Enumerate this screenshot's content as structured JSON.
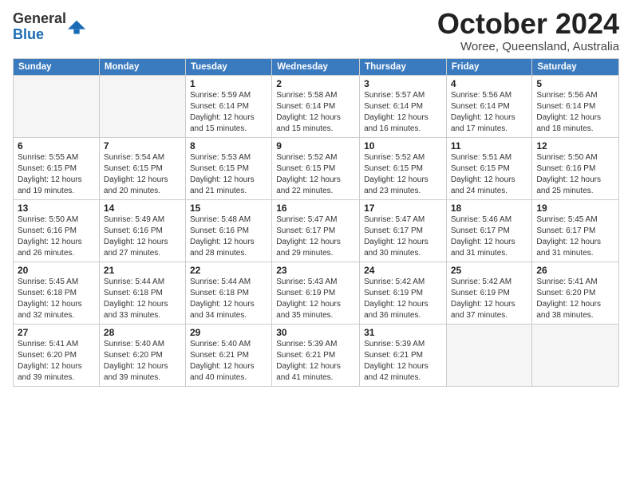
{
  "logo": {
    "general": "General",
    "blue": "Blue"
  },
  "header": {
    "month": "October 2024",
    "location": "Woree, Queensland, Australia"
  },
  "weekdays": [
    "Sunday",
    "Monday",
    "Tuesday",
    "Wednesday",
    "Thursday",
    "Friday",
    "Saturday"
  ],
  "weeks": [
    [
      {
        "day": "",
        "info": ""
      },
      {
        "day": "",
        "info": ""
      },
      {
        "day": "1",
        "info": "Sunrise: 5:59 AM\nSunset: 6:14 PM\nDaylight: 12 hours and 15 minutes."
      },
      {
        "day": "2",
        "info": "Sunrise: 5:58 AM\nSunset: 6:14 PM\nDaylight: 12 hours and 15 minutes."
      },
      {
        "day": "3",
        "info": "Sunrise: 5:57 AM\nSunset: 6:14 PM\nDaylight: 12 hours and 16 minutes."
      },
      {
        "day": "4",
        "info": "Sunrise: 5:56 AM\nSunset: 6:14 PM\nDaylight: 12 hours and 17 minutes."
      },
      {
        "day": "5",
        "info": "Sunrise: 5:56 AM\nSunset: 6:14 PM\nDaylight: 12 hours and 18 minutes."
      }
    ],
    [
      {
        "day": "6",
        "info": "Sunrise: 5:55 AM\nSunset: 6:15 PM\nDaylight: 12 hours and 19 minutes."
      },
      {
        "day": "7",
        "info": "Sunrise: 5:54 AM\nSunset: 6:15 PM\nDaylight: 12 hours and 20 minutes."
      },
      {
        "day": "8",
        "info": "Sunrise: 5:53 AM\nSunset: 6:15 PM\nDaylight: 12 hours and 21 minutes."
      },
      {
        "day": "9",
        "info": "Sunrise: 5:52 AM\nSunset: 6:15 PM\nDaylight: 12 hours and 22 minutes."
      },
      {
        "day": "10",
        "info": "Sunrise: 5:52 AM\nSunset: 6:15 PM\nDaylight: 12 hours and 23 minutes."
      },
      {
        "day": "11",
        "info": "Sunrise: 5:51 AM\nSunset: 6:15 PM\nDaylight: 12 hours and 24 minutes."
      },
      {
        "day": "12",
        "info": "Sunrise: 5:50 AM\nSunset: 6:16 PM\nDaylight: 12 hours and 25 minutes."
      }
    ],
    [
      {
        "day": "13",
        "info": "Sunrise: 5:50 AM\nSunset: 6:16 PM\nDaylight: 12 hours and 26 minutes."
      },
      {
        "day": "14",
        "info": "Sunrise: 5:49 AM\nSunset: 6:16 PM\nDaylight: 12 hours and 27 minutes."
      },
      {
        "day": "15",
        "info": "Sunrise: 5:48 AM\nSunset: 6:16 PM\nDaylight: 12 hours and 28 minutes."
      },
      {
        "day": "16",
        "info": "Sunrise: 5:47 AM\nSunset: 6:17 PM\nDaylight: 12 hours and 29 minutes."
      },
      {
        "day": "17",
        "info": "Sunrise: 5:47 AM\nSunset: 6:17 PM\nDaylight: 12 hours and 30 minutes."
      },
      {
        "day": "18",
        "info": "Sunrise: 5:46 AM\nSunset: 6:17 PM\nDaylight: 12 hours and 31 minutes."
      },
      {
        "day": "19",
        "info": "Sunrise: 5:45 AM\nSunset: 6:17 PM\nDaylight: 12 hours and 31 minutes."
      }
    ],
    [
      {
        "day": "20",
        "info": "Sunrise: 5:45 AM\nSunset: 6:18 PM\nDaylight: 12 hours and 32 minutes."
      },
      {
        "day": "21",
        "info": "Sunrise: 5:44 AM\nSunset: 6:18 PM\nDaylight: 12 hours and 33 minutes."
      },
      {
        "day": "22",
        "info": "Sunrise: 5:44 AM\nSunset: 6:18 PM\nDaylight: 12 hours and 34 minutes."
      },
      {
        "day": "23",
        "info": "Sunrise: 5:43 AM\nSunset: 6:19 PM\nDaylight: 12 hours and 35 minutes."
      },
      {
        "day": "24",
        "info": "Sunrise: 5:42 AM\nSunset: 6:19 PM\nDaylight: 12 hours and 36 minutes."
      },
      {
        "day": "25",
        "info": "Sunrise: 5:42 AM\nSunset: 6:19 PM\nDaylight: 12 hours and 37 minutes."
      },
      {
        "day": "26",
        "info": "Sunrise: 5:41 AM\nSunset: 6:20 PM\nDaylight: 12 hours and 38 minutes."
      }
    ],
    [
      {
        "day": "27",
        "info": "Sunrise: 5:41 AM\nSunset: 6:20 PM\nDaylight: 12 hours and 39 minutes."
      },
      {
        "day": "28",
        "info": "Sunrise: 5:40 AM\nSunset: 6:20 PM\nDaylight: 12 hours and 39 minutes."
      },
      {
        "day": "29",
        "info": "Sunrise: 5:40 AM\nSunset: 6:21 PM\nDaylight: 12 hours and 40 minutes."
      },
      {
        "day": "30",
        "info": "Sunrise: 5:39 AM\nSunset: 6:21 PM\nDaylight: 12 hours and 41 minutes."
      },
      {
        "day": "31",
        "info": "Sunrise: 5:39 AM\nSunset: 6:21 PM\nDaylight: 12 hours and 42 minutes."
      },
      {
        "day": "",
        "info": ""
      },
      {
        "day": "",
        "info": ""
      }
    ]
  ]
}
